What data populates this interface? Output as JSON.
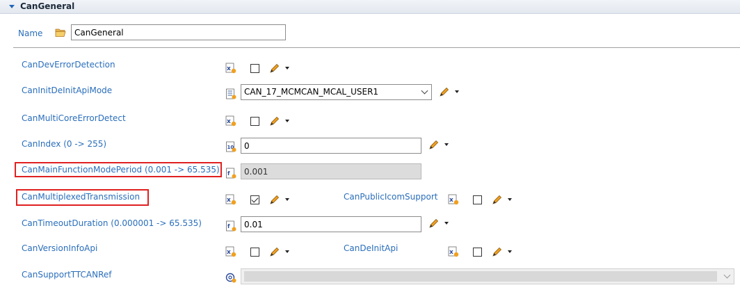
{
  "section": {
    "title": "CanGeneral"
  },
  "name": {
    "label": "Name",
    "value": "CanGeneral"
  },
  "params": {
    "dev_error_detection": {
      "label": "CanDevErrorDetection",
      "checked": false
    },
    "init_deinit_api_mode": {
      "label": "CanInitDeInitApiMode",
      "value": "CAN_17_MCMCAN_MCAL_USER1"
    },
    "multicore_error_detect": {
      "label": "CanMultiCoreErrorDetect",
      "checked": false
    },
    "can_index": {
      "label": "CanIndex (0 -> 255)",
      "value": "0"
    },
    "main_function_mode_period": {
      "label": "CanMainFunctionModePeriod (0.001 -> 65.535)",
      "value": "0.001"
    },
    "multiplexed_transmission": {
      "label": "CanMultiplexedTransmission",
      "checked": true
    },
    "public_icom_support": {
      "label": "CanPublicIcomSupport",
      "checked": false
    },
    "timeout_duration": {
      "label": "CanTimeoutDuration (0.000001 -> 65.535)",
      "value": "0.01"
    },
    "version_info_api": {
      "label": "CanVersionInfoApi",
      "checked": false
    },
    "deinit_api": {
      "label": "CanDeInitApi",
      "checked": false
    },
    "support_ttcan_ref": {
      "label": "CanSupportTTCANRef",
      "value": ""
    }
  },
  "colors": {
    "label": "#2a6ebb",
    "highlight": "#e02020",
    "icon_orange": "#f0a020"
  }
}
